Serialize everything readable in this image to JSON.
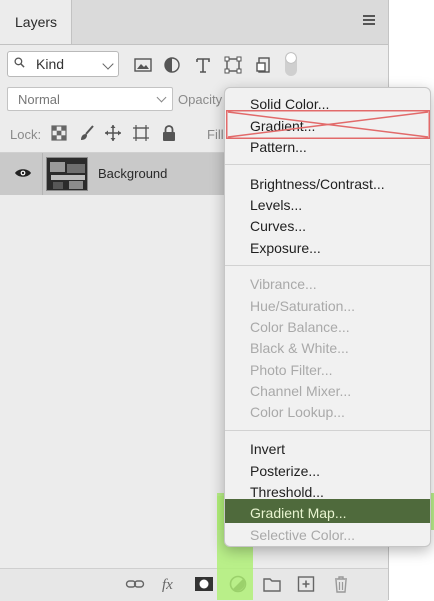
{
  "panel": {
    "tab_title": "Layers"
  },
  "filter": {
    "kind_label": "Kind",
    "icons": [
      "pixel-filter-icon",
      "adjustment-filter-icon",
      "type-filter-icon",
      "shape-filter-icon",
      "smart-object-filter-icon"
    ]
  },
  "blend": {
    "mode": "Normal",
    "opacity_label": "Opacity"
  },
  "lock": {
    "label": "Lock:",
    "fill_label": "Fill",
    "icons": [
      "lock-transparent-icon",
      "lock-paint-icon",
      "lock-position-icon",
      "lock-artboard-icon",
      "lock-all-icon"
    ]
  },
  "layers": [
    {
      "name": "Background",
      "visible": true
    }
  ],
  "bottom_icons": [
    "link-icon",
    "fx-icon",
    "mask-icon",
    "adjustment-layer-icon",
    "group-folder-icon",
    "new-layer-icon",
    "trash-icon"
  ],
  "menu": {
    "group1": [
      "Solid Color...",
      "Gradient...",
      "Pattern..."
    ],
    "group2": [
      "Brightness/Contrast...",
      "Levels...",
      "Curves...",
      "Exposure..."
    ],
    "group3": [
      "Vibrance...",
      "Hue/Saturation...",
      "Color Balance...",
      "Black & White...",
      "Photo Filter...",
      "Channel Mixer...",
      "Color Lookup..."
    ],
    "group4": [
      "Invert",
      "Posterize...",
      "Threshold...",
      "Gradient Map...",
      "Selective Color..."
    ],
    "selected_item": "Gradient Map...",
    "crossed_out_item": "Gradient..."
  },
  "colors": {
    "highlight": "#b0f078",
    "selected_bg": "#4f6a3c",
    "cross_mark": "#e26a6a"
  }
}
